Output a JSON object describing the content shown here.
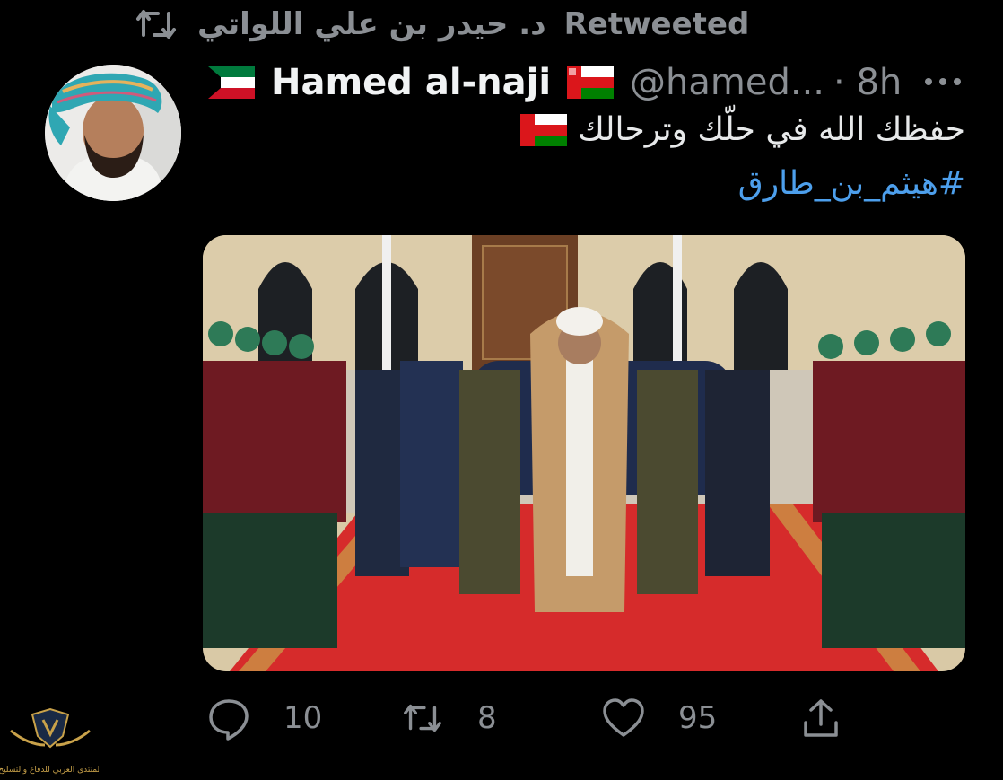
{
  "retweet": {
    "retweeter": "د. حيدر بن علي اللواتي",
    "label": "Retweeted"
  },
  "author": {
    "name": "Hamed al-naji",
    "handle": "@hamed...",
    "time": "· 8h"
  },
  "tweet": {
    "text": "حفظك الله في حلّك وترحالك",
    "hashtag": "#هيثم_بن_طارق"
  },
  "stats": {
    "replies": "10",
    "retweets": "8",
    "likes": "95"
  },
  "watermark": {
    "text": "المنتدى العربي للدفاع والتسليح"
  },
  "icons": {
    "retweet": "retweet-icon",
    "more": "more-icon",
    "reply": "reply-icon",
    "like": "heart-icon",
    "share": "share-icon",
    "flag_left": "kuwait-flag-icon",
    "flag_right": "oman-flag-icon",
    "flag_text": "oman-flag-icon"
  },
  "colors": {
    "background": "#000000",
    "text": "#e7e9ea",
    "muted": "#8b8f94",
    "link": "#4d9fec"
  }
}
